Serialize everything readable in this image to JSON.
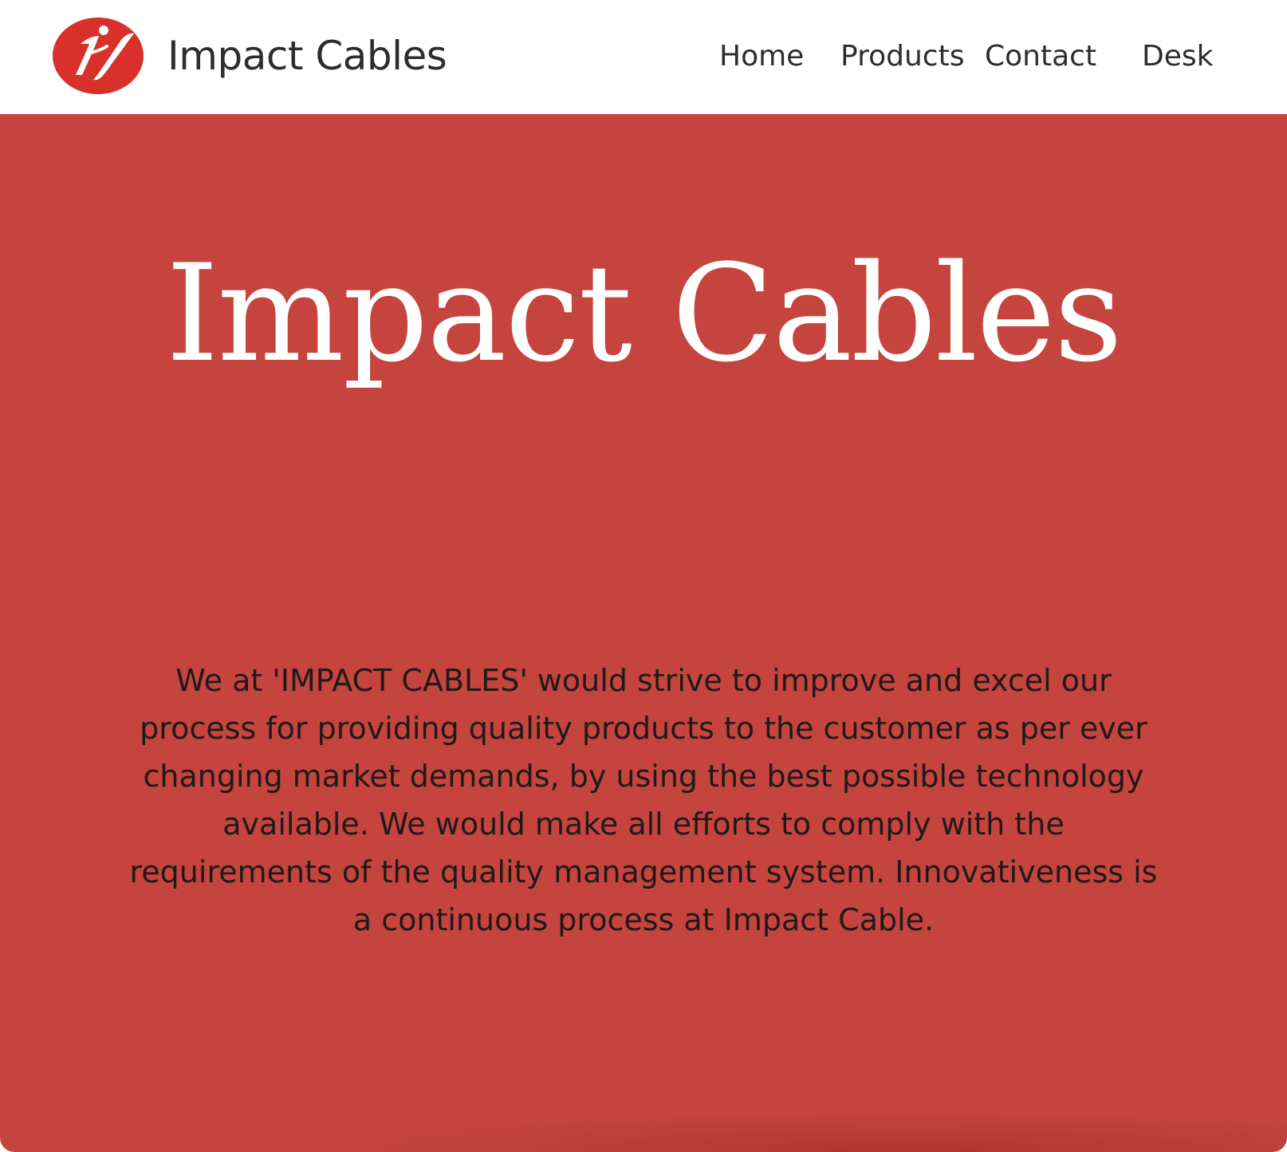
{
  "header": {
    "brand_name": "Impact Cables",
    "logo_icon": "impact-cables-logo-icon",
    "nav": {
      "home": "Home",
      "products": "Products",
      "contact": "Contact",
      "desk": "Desk"
    }
  },
  "hero": {
    "title": "Impact Cables",
    "body": "We at 'IMPACT CABLES' would strive to improve and excel our process for providing quality products to the customer as per ever changing market demands, by using the best possible technology available. We would make all efforts to comply with the requirements of the quality management system. Innovativeness is a continuous process at Impact Cable."
  },
  "colors": {
    "accent": "#c5443d",
    "logo_red": "#d8302a",
    "text_dark": "#2d2d2d",
    "hero_text": "#ffffff"
  }
}
